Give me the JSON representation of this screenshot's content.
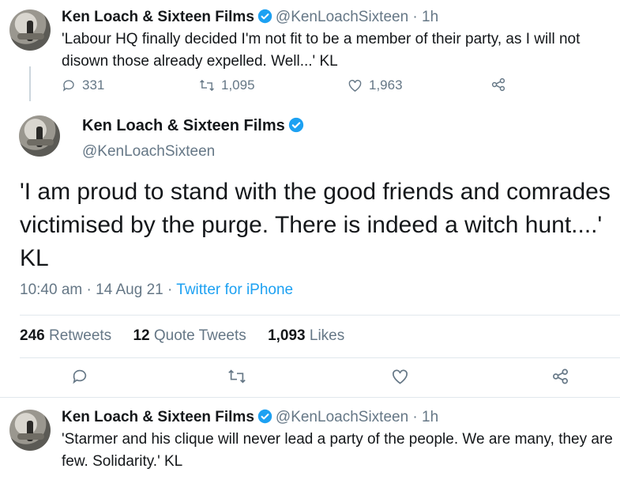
{
  "tweet1": {
    "name": "Ken Loach & Sixteen Films",
    "handle": "@KenLoachSixteen",
    "time": "1h",
    "text": "'Labour HQ finally decided I'm not fit to be a member of their party, as I will not disown those already expelled. Well...' KL",
    "replies": "331",
    "retweets": "1,095",
    "likes": "1,963"
  },
  "main": {
    "name": "Ken Loach & Sixteen Films",
    "handle": "@KenLoachSixteen",
    "text": "'I am proud to stand with the good friends and comrades victimised by the purge. There is indeed a witch hunt....' KL",
    "time": "10:40 am",
    "date": "14 Aug 21",
    "source": "Twitter for iPhone",
    "retweets_count": "246",
    "retweets_label": "Retweets",
    "quotes_count": "12",
    "quotes_label": "Quote Tweets",
    "likes_count": "1,093",
    "likes_label": "Likes"
  },
  "tweet3": {
    "name": "Ken Loach & Sixteen Films",
    "handle": "@KenLoachSixteen",
    "time": "1h",
    "text": "'Starmer and his clique will never lead a party of the people. We are many, they are few. Solidarity.' KL"
  },
  "colors": {
    "verified": "#1da1f2",
    "link": "#1da1f2",
    "muted": "#657786"
  },
  "icons": [
    "reply-icon",
    "retweet-icon",
    "like-icon",
    "share-icon",
    "verified-badge-icon"
  ]
}
